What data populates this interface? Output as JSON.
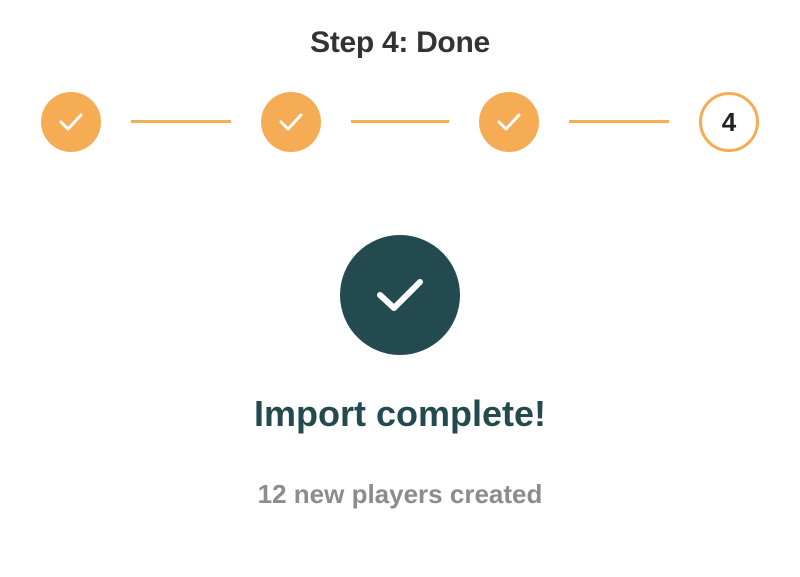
{
  "header": {
    "title": "Step 4: Done"
  },
  "stepper": {
    "steps": [
      {
        "status": "done",
        "icon": "check-icon"
      },
      {
        "status": "done",
        "icon": "check-icon"
      },
      {
        "status": "done",
        "icon": "check-icon"
      },
      {
        "status": "current",
        "number": "4"
      }
    ]
  },
  "result": {
    "icon": "check-circle-icon",
    "headline": "Import complete!",
    "subtext": "12 new players created"
  },
  "colors": {
    "accent": "#f5ac55",
    "success_dark": "#234b4f",
    "title_text": "#333333",
    "muted_text": "#8c8c8c"
  }
}
